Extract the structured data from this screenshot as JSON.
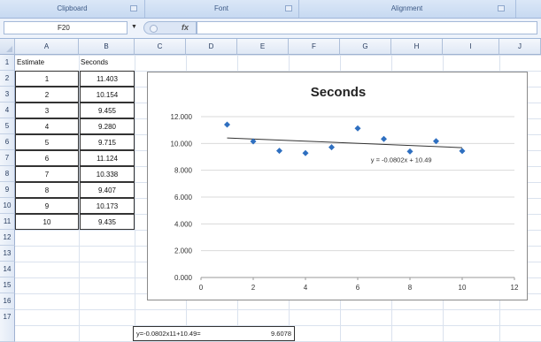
{
  "ribbon": {
    "groups": [
      "Clipboard",
      "Font",
      "Alignment"
    ]
  },
  "formula_bar": {
    "name_box": "F20",
    "fx_label": "fx",
    "formula": ""
  },
  "columns": [
    "A",
    "B",
    "C",
    "D",
    "E",
    "F",
    "G",
    "H",
    "I",
    "J"
  ],
  "rows": [
    "1",
    "2",
    "3",
    "4",
    "5",
    "6",
    "7",
    "8",
    "9",
    "10",
    "11",
    "12",
    "13",
    "14",
    "15",
    "16",
    "17"
  ],
  "table": {
    "headers": [
      "Estimate",
      "Seconds"
    ],
    "estimates": [
      "1",
      "2",
      "3",
      "4",
      "5",
      "6",
      "7",
      "8",
      "9",
      "10"
    ],
    "seconds": [
      "11.403",
      "10.154",
      "9.455",
      "9.280",
      "9.715",
      "11.124",
      "10.338",
      "9.407",
      "10.173",
      "9.435"
    ]
  },
  "bottom_formula": {
    "expr": "y=-0.0802x11+10.49=",
    "result": "9.6078"
  },
  "chart_data": {
    "type": "scatter",
    "title": "Seconds",
    "x": [
      1,
      2,
      3,
      4,
      5,
      6,
      7,
      8,
      9,
      10
    ],
    "y": [
      11.403,
      10.154,
      9.455,
      9.28,
      9.715,
      11.124,
      10.338,
      9.407,
      10.173,
      9.435
    ],
    "xlim": [
      0,
      12
    ],
    "ylim": [
      0,
      12
    ],
    "x_ticks": [
      "0",
      "2",
      "4",
      "6",
      "8",
      "10",
      "12"
    ],
    "y_ticks": [
      "0.000",
      "2.000",
      "4.000",
      "6.000",
      "8.000",
      "10.000",
      "12.000"
    ],
    "trendline": {
      "slope": -0.0802,
      "intercept": 10.49,
      "x_range": [
        1,
        10
      ],
      "label": "y = -0.0802x + 10.49"
    },
    "grid": true,
    "marker_color": "#2e6fc0",
    "trend_color": "#333333"
  }
}
